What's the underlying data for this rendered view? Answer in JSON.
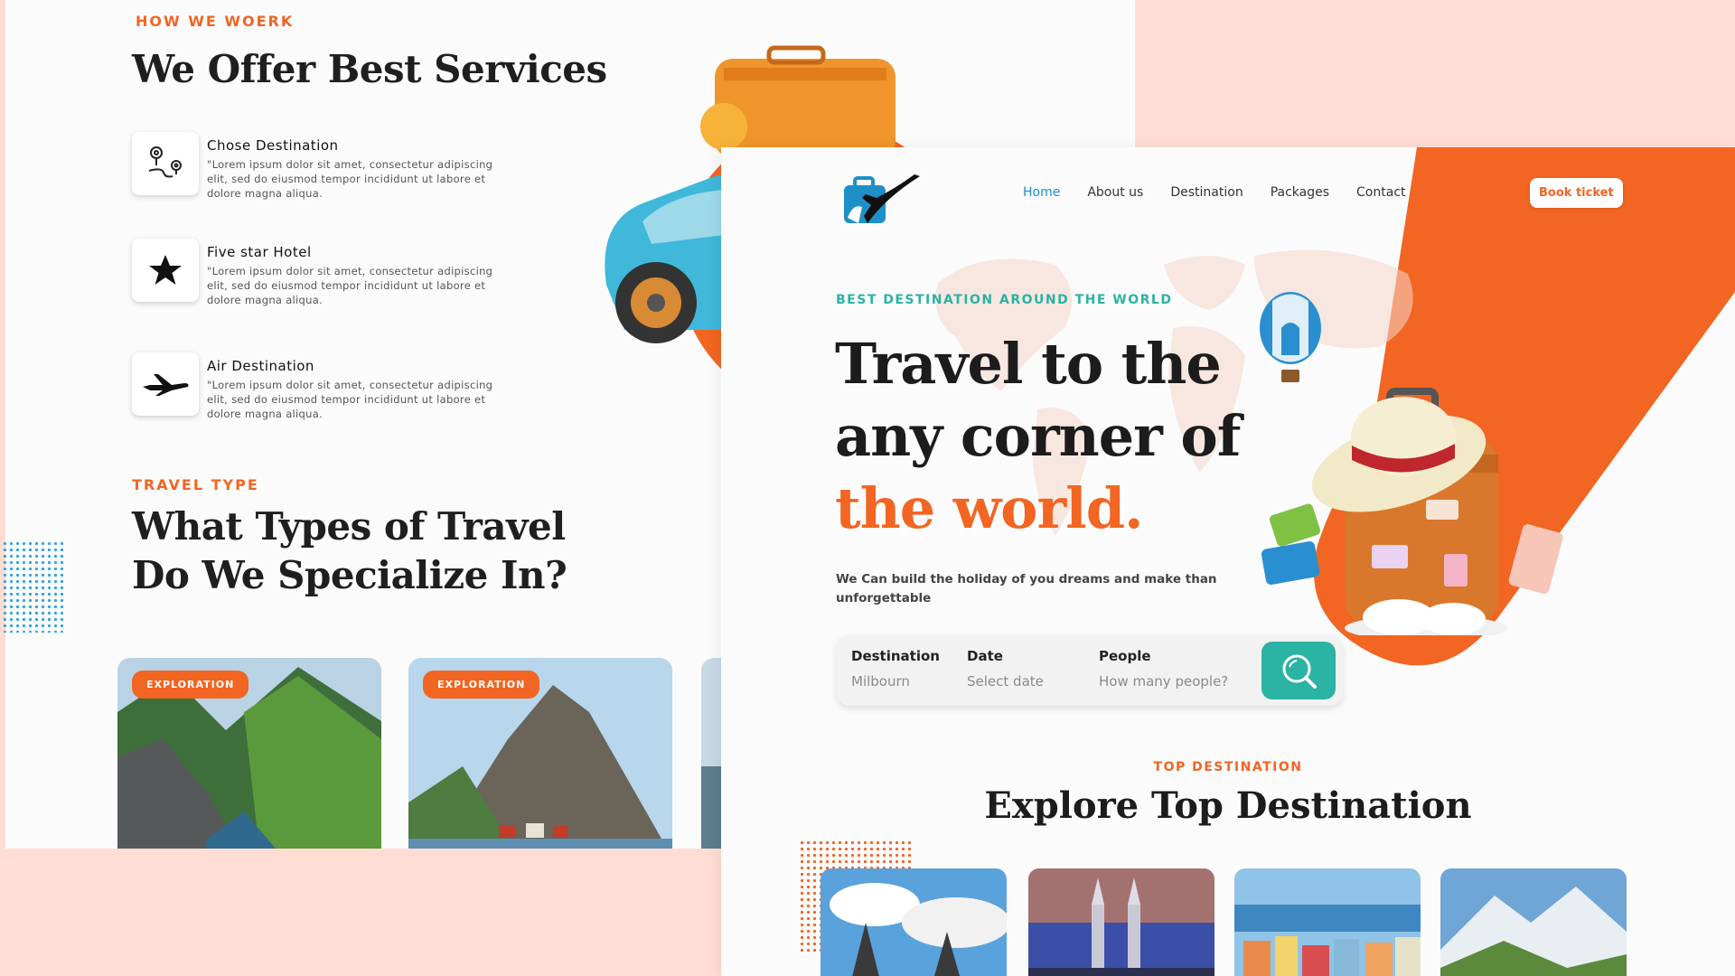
{
  "back_page": {
    "eyebrow": "HOW WE WOERK",
    "title": "We Offer Best Services",
    "services": [
      {
        "title": "Chose Destination",
        "desc": "\"Lorem ipsum dolor sit amet, consectetur adipiscing elit, sed do eiusmod tempor incididunt ut labore et dolore magna aliqua.",
        "icon": "map-pin-route-icon"
      },
      {
        "title": "Five star Hotel",
        "desc": "\"Lorem ipsum dolor sit amet, consectetur adipiscing elit, sed do eiusmod tempor incididunt ut labore et dolore magna aliqua.",
        "icon": "star-icon"
      },
      {
        "title": "Air Destination",
        "desc": "\"Lorem ipsum dolor sit amet, consectetur adipiscing elit, sed do eiusmod tempor incididunt ut labore et dolore magna aliqua.",
        "icon": "airplane-icon"
      }
    ],
    "travel_type_eyebrow": "TRAVEL TYPE",
    "travel_type_title": "What Types of Travel Do We Specialize In?",
    "cards": [
      {
        "badge": "EXPLORATION"
      },
      {
        "badge": "EXPLORATION"
      }
    ]
  },
  "front_page": {
    "nav": [
      {
        "label": "Home",
        "active": true
      },
      {
        "label": "About us"
      },
      {
        "label": "Destination"
      },
      {
        "label": "Packages"
      },
      {
        "label": "Contact"
      }
    ],
    "book_button": "Book ticket",
    "hero": {
      "eyebrow": "BEST DESTINATION AROUND THE WORLD",
      "title_line1": "Travel to the",
      "title_line2": "any corner of",
      "title_highlight": "the world.",
      "subtitle": "We Can build the holiday of you dreams and make than unforgettable"
    },
    "search": {
      "destination_label": "Destination",
      "destination_value": "Milbourn",
      "date_label": "Date",
      "date_placeholder": "Select date",
      "people_label": "People",
      "people_placeholder": "How many people?"
    },
    "top_destination_eyebrow": "TOP DESTINATION",
    "top_destination_title": "Explore Top Destination"
  },
  "colors": {
    "accent_orange": "#f26522",
    "teal": "#2bb3a3",
    "nav_active_blue": "#1e90c8",
    "background_pink": "#ffddd5"
  }
}
